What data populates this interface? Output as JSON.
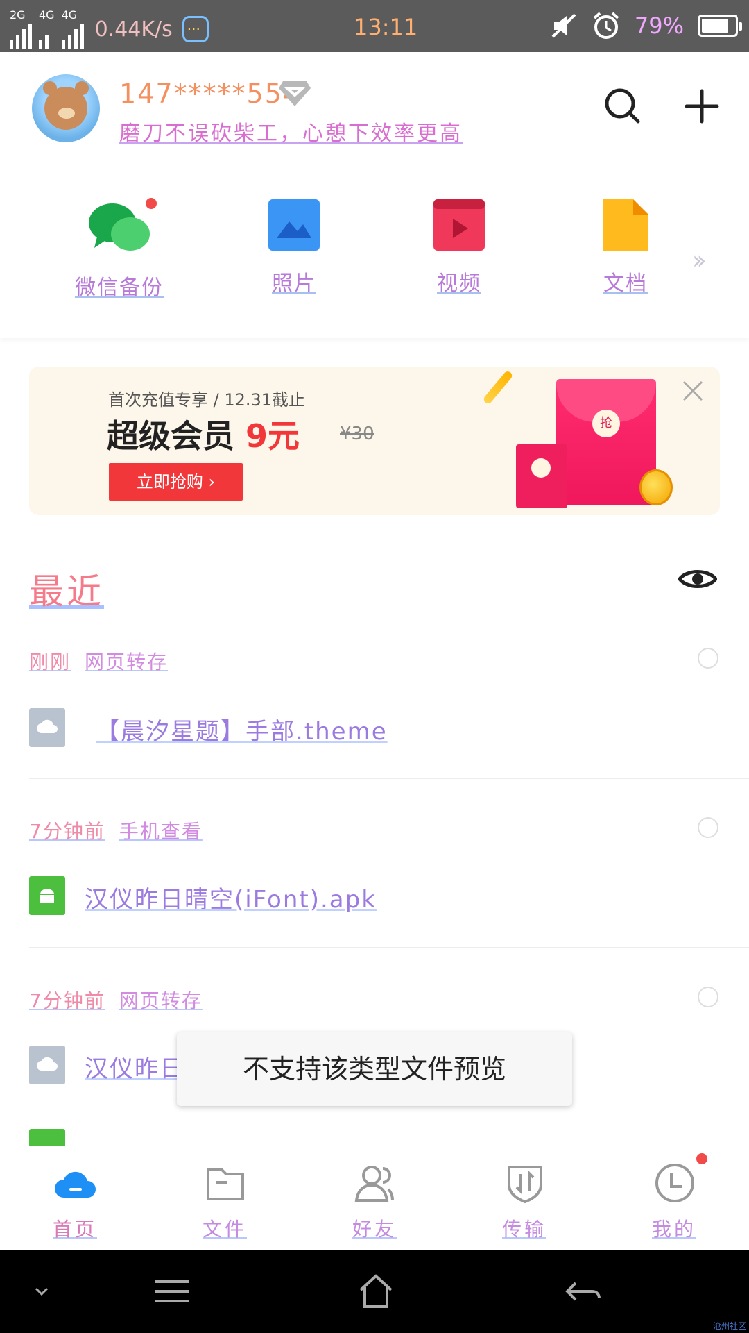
{
  "status_bar": {
    "net_labels": [
      "2G",
      "4G",
      "4G"
    ],
    "speed": "0.44K/s",
    "time": "13:11",
    "battery_pct": "79%",
    "battery_level": 0.79
  },
  "profile": {
    "username": "147*****554",
    "motto": "磨刀不误砍柴工，心憩下效率更高"
  },
  "quick_actions": [
    {
      "label": "微信备份",
      "icon": "wechat-icon",
      "color": "#22b24c"
    },
    {
      "label": "照片",
      "icon": "photo-icon",
      "color": "#3a8ff0"
    },
    {
      "label": "视频",
      "icon": "video-icon",
      "color": "#f03a5c"
    },
    {
      "label": "文档",
      "icon": "document-icon",
      "color": "#ffb71b"
    }
  ],
  "banner": {
    "subtitle": "首次充值专享 / 12.31截止",
    "title": "超级会员",
    "price": "9元",
    "old_price": "¥30",
    "button": "立即抢购 ›",
    "seal_text": "抢"
  },
  "recent": {
    "title": "最近",
    "groups": [
      {
        "time": "刚刚",
        "source": "网页转存",
        "file": "【晨汐星题】手部.theme",
        "type": "cloud"
      },
      {
        "time": "7分钟前",
        "source": "手机查看",
        "file": "汉仪昨日晴空(iFont).apk",
        "type": "apk"
      },
      {
        "time": "7分钟前",
        "source": "网页转存",
        "file": "汉仪昨日晴空",
        "type": "cloud"
      }
    ]
  },
  "toast": "不支持该类型文件预览",
  "tabs": [
    {
      "label": "首页",
      "icon": "cloud-home-icon"
    },
    {
      "label": "文件",
      "icon": "folder-icon"
    },
    {
      "label": "好友",
      "icon": "friends-icon"
    },
    {
      "label": "传输",
      "icon": "transfer-icon"
    },
    {
      "label": "我的",
      "icon": "me-icon"
    }
  ],
  "watermark": "沧州社区"
}
